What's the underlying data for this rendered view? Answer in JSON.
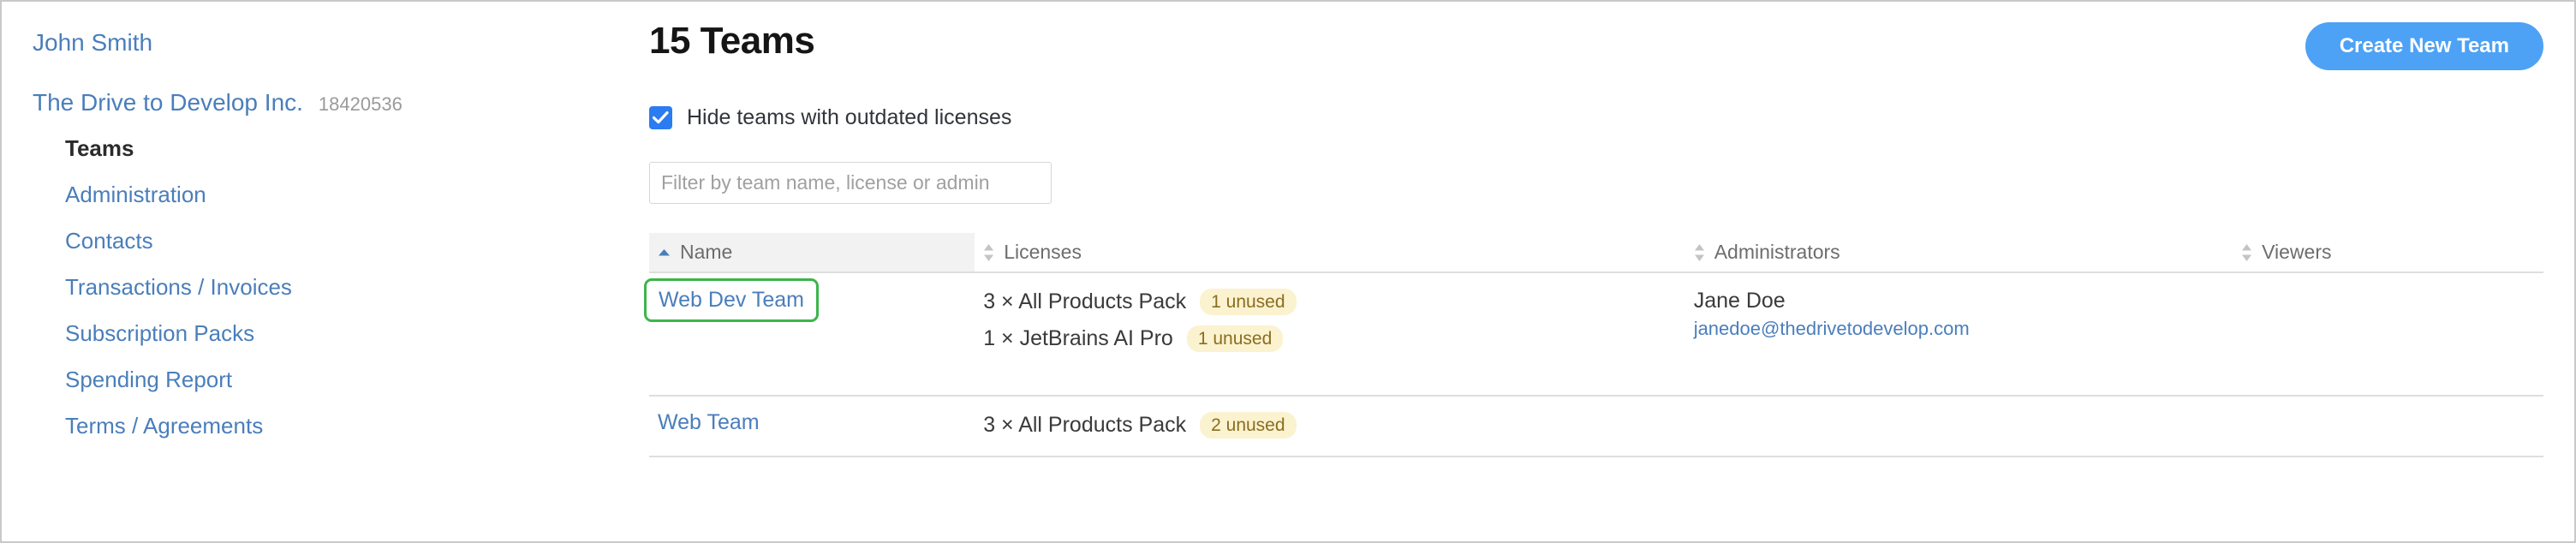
{
  "sidebar": {
    "user": "John Smith",
    "org_name": "The Drive to Develop Inc.",
    "org_id": "18420536",
    "items": [
      {
        "label": "Teams",
        "active": true
      },
      {
        "label": "Administration",
        "active": false
      },
      {
        "label": "Contacts",
        "active": false
      },
      {
        "label": "Transactions / Invoices",
        "active": false
      },
      {
        "label": "Subscription Packs",
        "active": false
      },
      {
        "label": "Spending Report",
        "active": false
      },
      {
        "label": "Terms / Agreements",
        "active": false
      }
    ]
  },
  "header": {
    "title": "15 Teams",
    "create_button": "Create New Team"
  },
  "controls": {
    "hide_outdated_label": "Hide teams with outdated licenses",
    "hide_outdated_checked": true,
    "filter_placeholder": "Filter by team name, license or admin",
    "filter_value": ""
  },
  "table": {
    "columns": [
      {
        "label": "Name",
        "sort": "asc"
      },
      {
        "label": "Licenses",
        "sort": "none"
      },
      {
        "label": "Administrators",
        "sort": "none"
      },
      {
        "label": "Viewers",
        "sort": "none"
      }
    ],
    "rows": [
      {
        "name": "Web Dev Team",
        "focused": true,
        "licenses": [
          {
            "text": "3 × All Products Pack",
            "badge": "1 unused"
          },
          {
            "text": "1 × JetBrains AI Pro",
            "badge": "1 unused"
          }
        ],
        "admin_name": "Jane Doe",
        "admin_email": "janedoe@thedrivetodevelop.com",
        "viewers": ""
      },
      {
        "name": "Web Team",
        "focused": false,
        "licenses": [
          {
            "text": "3 × All Products Pack",
            "badge": "2 unused"
          }
        ],
        "admin_name": "",
        "admin_email": "",
        "viewers": ""
      }
    ]
  },
  "colors": {
    "link_blue": "#4a7ebb",
    "accent_blue": "#4da2f5",
    "checkbox_blue": "#2b7cf0",
    "focus_green": "#3cb54a",
    "badge_bg": "#fbf2cf",
    "badge_text": "#8a6d21"
  }
}
